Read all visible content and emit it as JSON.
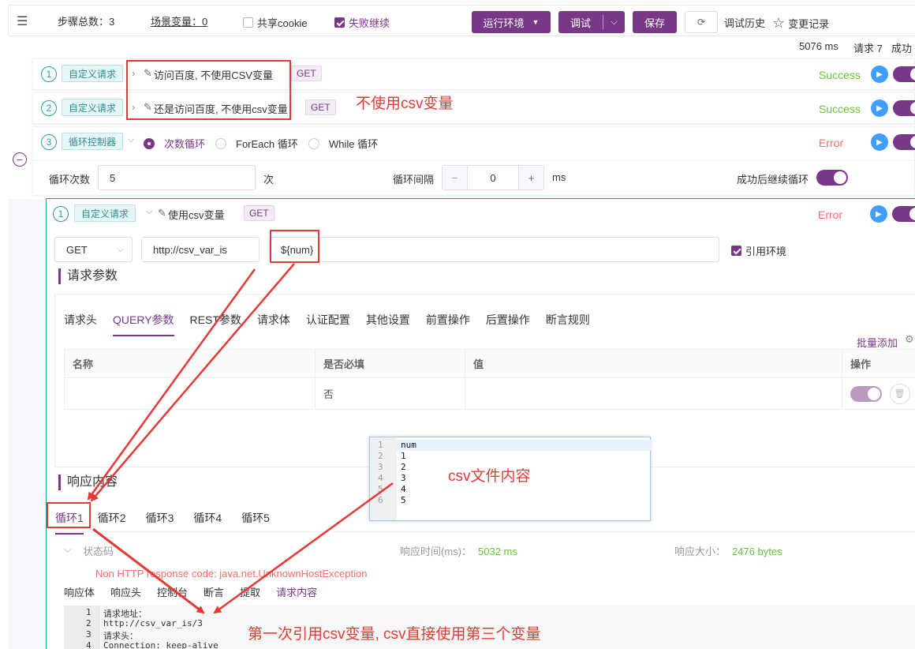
{
  "toolbar": {
    "steps_label": "步骤总数：3",
    "vars_label": "场景变量：0",
    "share_cookie": "共享cookie",
    "fail_continue": "失败继续",
    "env_button": "运行环境",
    "debug_button": "调试",
    "save_button": "保存",
    "history": "调试历史",
    "changes": "变更记录"
  },
  "summary": {
    "time": "5076 ms",
    "requests": "请求 7",
    "success": "成功"
  },
  "steps": [
    {
      "num": "1",
      "type": "自定义请求",
      "name": "访问百度, 不使用CSV变量",
      "method": "GET",
      "status": "Success"
    },
    {
      "num": "2",
      "type": "自定义请求",
      "name": "还是访问百度, 不使用csv变量",
      "method": "GET",
      "status": "Success"
    },
    {
      "num": "3",
      "type": "循环控制器",
      "status": "Error",
      "modes": [
        "次数循环",
        "ForEach 循环",
        "While 循环"
      ],
      "count_label": "循环次数",
      "count_value": "5",
      "count_unit": "次",
      "interval_label": "循环间隔",
      "interval_value": "0",
      "interval_unit": "ms",
      "continue_label": "成功后继续循环"
    }
  ],
  "child": {
    "num": "1",
    "type": "自定义请求",
    "name": "使用csv变量",
    "method": "GET",
    "status": "Error",
    "req_method": "GET",
    "url": "http://csv_var_is",
    "path": "${num}",
    "use_env": "引用环境",
    "params_title": "请求参数",
    "tabs": [
      "请求头",
      "QUERY参数",
      "REST参数",
      "请求体",
      "认证配置",
      "其他设置",
      "前置操作",
      "后置操作",
      "断言规则"
    ],
    "batch_add": "批量添加",
    "table": {
      "headers": [
        "名称",
        "是否必填",
        "值",
        "操作"
      ],
      "row": [
        "",
        "否",
        ""
      ]
    },
    "resp_title": "响应内容",
    "loops": [
      "循环1",
      "循环2",
      "循环3",
      "循环4",
      "循环5"
    ],
    "status_code": "状态码",
    "resp_time_label": "响应时间(ms)：",
    "resp_time": "5032 ms",
    "resp_size_label": "响应大小：",
    "resp_size": "2476 bytes",
    "error": "Non HTTP response code: java.net.UnknownHostException",
    "resp_tabs": [
      "响应体",
      "响应头",
      "控制台",
      "断言",
      "提取",
      "请求内容"
    ],
    "code_lines": [
      "请求地址：",
      "http://csv_var_is/3",
      "请求头：",
      "Connection: keep-alive"
    ]
  },
  "csv_popup": {
    "lines": [
      "num",
      "1",
      "2",
      "3",
      "4",
      "5"
    ]
  },
  "annotations": {
    "no_csv": "不使用csv变量",
    "csv_content": "csv文件内容",
    "first_ref": "第一次引用csv变量, csv直接使用第三个变量"
  },
  "colors": {
    "accent": "#783887",
    "teal": "#1fa1a1",
    "success": "#67c23a",
    "error": "#f56c6c",
    "annotation": "#e53935"
  }
}
